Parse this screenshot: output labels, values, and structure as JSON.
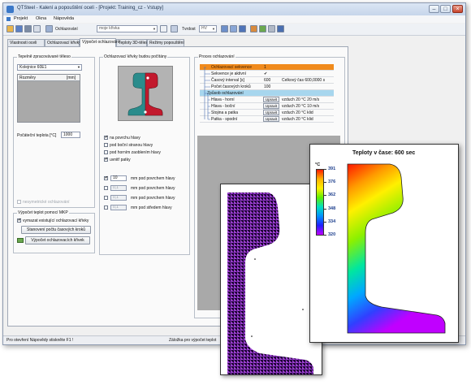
{
  "app": {
    "title": "QTSteel - Kalení a popouštění ocelí - [Projekt: Training_cz - Vstupy]",
    "menu": [
      "Projekt",
      "Okna",
      "Nápověda"
    ]
  },
  "toolbar": {
    "cooling_label": "Ochlazování",
    "cooling_value": "moje křivka",
    "hardness_label": "Tvrdost",
    "hardness_value": "HV"
  },
  "tabs": [
    "Vlastnosti oceli",
    "Ochlazovací křivky",
    "Výpočet ochlazování",
    "Teploty 3D-těleso",
    "Režimy popouštění"
  ],
  "active_tab_index": 2,
  "body_group": {
    "title": "Tepelně zpracovávané těleso",
    "body_value": "Kolejnice 60E1",
    "dims_header": "Rozměry",
    "dims_unit": "[mm]",
    "init_temp_label": "Počáteční teplota [°C]",
    "init_temp_value": "1000",
    "nonsym_label": "nesymetrické ochlazování"
  },
  "calc_group": {
    "title": "Výpočet teplot pomocí MKP",
    "use_existing_label": "vymazat existující ochlazovací křivky",
    "steps_button": "Stanovení počtu časových kroků",
    "compute_button": "Výpočet ochlazovacích křivek"
  },
  "curves_group": {
    "title": "Ochlazovací křivky budou počítány",
    "points": [
      {
        "label": "na povrchu hlavy",
        "checked": true
      },
      {
        "label": "pod boční stranou hlavy",
        "checked": false
      },
      {
        "label": "pod horním zaoblením hlavy",
        "checked": false
      },
      {
        "label": "uvnitř patky",
        "checked": true
      }
    ],
    "depths": [
      {
        "value": "10",
        "label": "mm pod povrchem hlavy",
        "checked": true
      },
      {
        "value": "0,1",
        "label": "mm pod povrchem hlavy",
        "checked": false
      },
      {
        "value": "0,1",
        "label": "mm pod povrchem hlavy",
        "checked": false
      },
      {
        "value": "0,1",
        "label": "mm pod středem hlavy",
        "checked": false
      }
    ]
  },
  "process_group": {
    "title": "Proces ochlazování",
    "header": {
      "key": "Ochlazovací sekvence",
      "value": "1"
    },
    "rows": [
      {
        "key": "Sekvence je aktivní",
        "value": "✔",
        "note": ""
      },
      {
        "key": "Časový interval [s]",
        "value": "600",
        "note": "Celkový čas 600,0000 s"
      },
      {
        "key": "Počet časových kroků",
        "value": "100",
        "note": ""
      }
    ],
    "cooling_header": "Způsob ochlazování",
    "cooling_rows": [
      {
        "key": "Hlava - horní",
        "button": "Upravit",
        "note": "vzduch 20 °C 20 m/s"
      },
      {
        "key": "Hlava - boční",
        "button": "Upravit",
        "note": "vzduch 20 °C 10 m/s"
      },
      {
        "key": "Stojina a patka",
        "button": "Upravit",
        "note": "vzduch 20 °C klid"
      },
      {
        "key": "Patka - spodní",
        "button": "Upravit",
        "note": "vzduch 20 °C klid"
      }
    ]
  },
  "status": {
    "left": "Pro otevření Nápovědy stiskněte F1 !",
    "right": "Záložka pro výpočet teplot"
  },
  "heatmap": {
    "title": "Teploty v čase: 600 sec",
    "unit": "°C",
    "scale": [
      391,
      376,
      362,
      348,
      334,
      320
    ]
  }
}
